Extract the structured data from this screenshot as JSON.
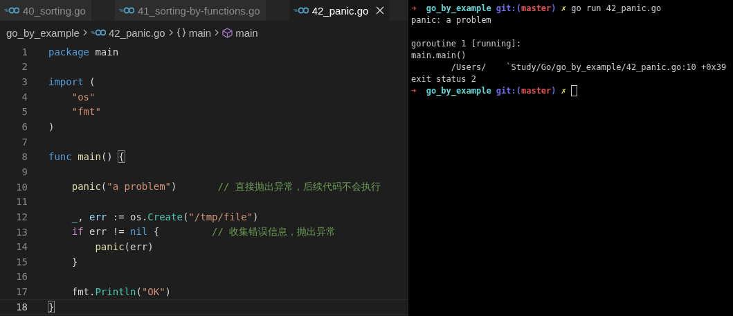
{
  "tabs": [
    {
      "label": "40_sorting.go",
      "selected": false
    },
    {
      "label": "41_sorting-by-functions.go",
      "selected": false
    },
    {
      "label": "42_panic.go",
      "selected": true
    }
  ],
  "breadcrumb": [
    {
      "kind": "folder",
      "label": "go_by_example"
    },
    {
      "kind": "file",
      "label": "42_panic.go"
    },
    {
      "kind": "namespace",
      "label": "main"
    },
    {
      "kind": "function",
      "label": "main"
    }
  ],
  "code_lines": [
    {
      "number": "1",
      "current": false,
      "tokens": [
        {
          "kind": "keyword",
          "text": "package"
        },
        {
          "kind": "plain",
          "text": " main"
        }
      ]
    },
    {
      "number": "2",
      "current": false
    },
    {
      "number": "3",
      "current": false,
      "tokens": [
        {
          "kind": "keyword",
          "text": "import"
        },
        {
          "kind": "plain",
          "text": " ("
        }
      ]
    },
    {
      "number": "4",
      "current": false,
      "tokens": [
        {
          "kind": "string",
          "text": "    \"os\""
        }
      ]
    },
    {
      "number": "5",
      "current": false,
      "tokens": [
        {
          "kind": "string",
          "text": "    \"fmt\""
        }
      ]
    },
    {
      "number": "6",
      "current": false,
      "tokens": [
        {
          "kind": "plain",
          "text": ")"
        }
      ]
    },
    {
      "number": "7",
      "current": false
    },
    {
      "number": "8",
      "current": false,
      "tokens": [
        {
          "kind": "keyword",
          "text": "func"
        },
        {
          "kind": "func",
          "text": " main"
        },
        {
          "kind": "plain",
          "text": "() "
        },
        {
          "kind": "bracket",
          "text": "{"
        }
      ]
    },
    {
      "number": "9",
      "current": false
    },
    {
      "number": "10",
      "current": false,
      "tokens": [
        {
          "kind": "func",
          "text": "    panic"
        },
        {
          "kind": "plain",
          "text": "("
        },
        {
          "kind": "string",
          "text": "\"a problem\""
        },
        {
          "kind": "plain",
          "text": ")       "
        },
        {
          "kind": "comment",
          "text": "// 直接抛出异常，后续代码不会执行"
        }
      ]
    },
    {
      "number": "11",
      "current": false
    },
    {
      "number": "12",
      "current": false,
      "tokens": [
        {
          "kind": "variable",
          "text": "    _"
        },
        {
          "kind": "plain",
          "text": ", "
        },
        {
          "kind": "variable",
          "text": "err"
        },
        {
          "kind": "plain",
          "text": " := os."
        },
        {
          "kind": "type",
          "text": "Create"
        },
        {
          "kind": "plain",
          "text": "("
        },
        {
          "kind": "string",
          "text": "\"/tmp/file\""
        },
        {
          "kind": "plain",
          "text": ")"
        }
      ]
    },
    {
      "number": "13",
      "current": false,
      "tokens": [
        {
          "kind": "control",
          "text": "    if"
        },
        {
          "kind": "plain",
          "text": " err != "
        },
        {
          "kind": "keyword",
          "text": "nil"
        },
        {
          "kind": "plain",
          "text": " {         "
        },
        {
          "kind": "comment",
          "text": "// 收集错误信息，抛出异常"
        }
      ]
    },
    {
      "number": "14",
      "current": false,
      "tokens": [
        {
          "kind": "func",
          "text": "        panic"
        },
        {
          "kind": "plain",
          "text": "(err)"
        }
      ]
    },
    {
      "number": "15",
      "current": false,
      "tokens": [
        {
          "kind": "plain",
          "text": "    }"
        }
      ]
    },
    {
      "number": "16",
      "current": false
    },
    {
      "number": "17",
      "current": false,
      "tokens": [
        {
          "kind": "plain",
          "text": "    fmt."
        },
        {
          "kind": "type",
          "text": "Println"
        },
        {
          "kind": "plain",
          "text": "("
        },
        {
          "kind": "string",
          "text": "\"OK\""
        },
        {
          "kind": "plain",
          "text": ")"
        }
      ]
    },
    {
      "number": "18",
      "current": true,
      "tokens": [
        {
          "kind": "bracket",
          "text": "}"
        }
      ]
    }
  ],
  "terminal_lines": [
    {
      "segments": [
        {
          "kind": "arrow",
          "text": "➜"
        },
        {
          "kind": "dir",
          "text": "  go_by_example"
        },
        {
          "kind": "git",
          "text": " git:("
        },
        {
          "kind": "branch",
          "text": "master"
        },
        {
          "kind": "git",
          "text": ")"
        },
        {
          "kind": "dirty",
          "text": " ✗"
        },
        {
          "kind": "plain",
          "text": " go run 42_panic.go"
        }
      ],
      "cursor": false
    },
    {
      "segments": [
        {
          "kind": "plain",
          "text": "panic: a problem"
        }
      ],
      "cursor": false
    },
    {
      "segments": [
        {
          "kind": "plain",
          "text": "goroutine 1 [running]:"
        }
      ],
      "cursor": false,
      "blank_line_before": true
    },
    {
      "segments": [
        {
          "kind": "plain",
          "text": "main.main()"
        }
      ],
      "cursor": false
    },
    {
      "segments": [
        {
          "kind": "plain",
          "text": "        /Users/    `Study/Go/go_by_example/42_panic.go:10 +0x39"
        }
      ],
      "cursor": false
    },
    {
      "segments": [
        {
          "kind": "plain",
          "text": "exit status 2"
        }
      ],
      "cursor": false
    },
    {
      "segments": [
        {
          "kind": "arrow",
          "text": "➜"
        },
        {
          "kind": "dir",
          "text": "  go_by_example"
        },
        {
          "kind": "git",
          "text": " git:("
        },
        {
          "kind": "branch",
          "text": "master"
        },
        {
          "kind": "git",
          "text": ")"
        },
        {
          "kind": "dirty",
          "text": " ✗"
        }
      ],
      "cursor": true
    }
  ]
}
